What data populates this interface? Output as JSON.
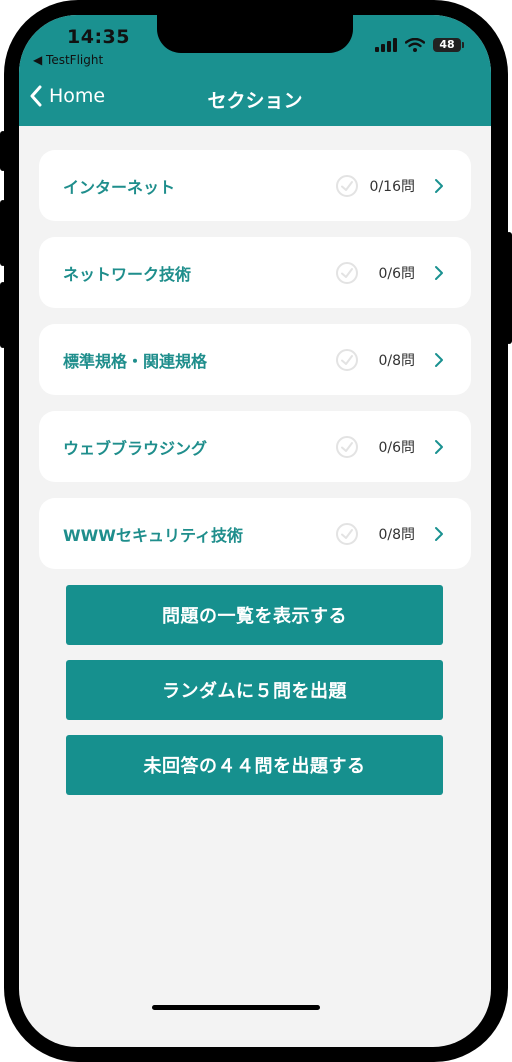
{
  "status_bar": {
    "time": "14:35",
    "back_app": "◀ TestFlight",
    "battery": "48"
  },
  "nav": {
    "back_label": "Home",
    "title": "セクション"
  },
  "sections": [
    {
      "name": "インターネット",
      "count": "0/16問"
    },
    {
      "name": "ネットワーク技術",
      "count": "0/6問"
    },
    {
      "name": "標準規格・関連規格",
      "count": "0/8問"
    },
    {
      "name": "ウェブブラウジング",
      "count": "0/6問"
    },
    {
      "name": "WWWセキュリティ技術",
      "count": "0/8問"
    }
  ],
  "actions": {
    "list_all": "問題の一覧を表示する",
    "random": "ランダムに５問を出題",
    "unanswered": "未回答の４４問を出題する"
  },
  "colors": {
    "accent": "#1a9190",
    "section_text": "#1f8e8c",
    "button": "#16908e",
    "background": "#f3f3f3"
  }
}
